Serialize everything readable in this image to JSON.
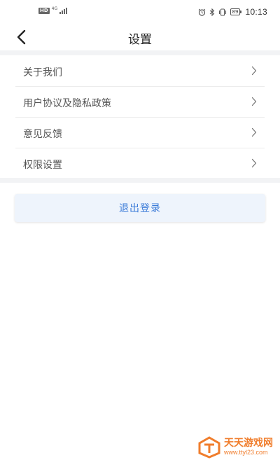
{
  "status_bar": {
    "hd": "HD",
    "network": "4G",
    "battery": "89",
    "time": "10:13"
  },
  "header": {
    "title": "设置"
  },
  "menu": {
    "items": [
      {
        "label": "关于我们"
      },
      {
        "label": "用户协议及隐私政策"
      },
      {
        "label": "意见反馈"
      },
      {
        "label": "权限设置"
      }
    ]
  },
  "logout": {
    "label": "退出登录"
  },
  "watermark": {
    "title": "天天游戏网",
    "url": "www.ttyl23.com"
  },
  "colors": {
    "accent": "#3b7bd8",
    "button_bg": "#eef4fc",
    "band": "#f2f3f5",
    "watermark": "#f07d2c"
  }
}
